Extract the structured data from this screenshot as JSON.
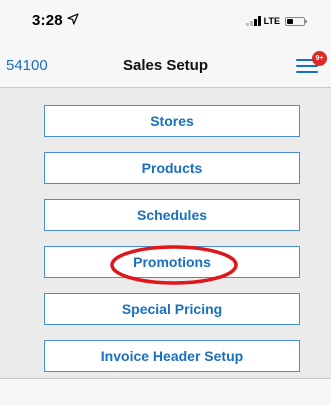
{
  "status_bar": {
    "time": "3:28",
    "network": "LTE",
    "battery_level": 0.35,
    "location_icon": "location-arrow-icon",
    "signal_icon": "signal-bars-icon",
    "battery_icon": "battery-icon"
  },
  "nav": {
    "left_label": "54100",
    "title": "Sales Setup",
    "menu_icon": "hamburger-menu-icon",
    "badge_text": "9+"
  },
  "menu": {
    "items": [
      {
        "label": "Stores"
      },
      {
        "label": "Products"
      },
      {
        "label": "Schedules"
      },
      {
        "label": "Promotions"
      },
      {
        "label": "Special Pricing"
      },
      {
        "label": "Invoice Header Setup"
      }
    ]
  },
  "annotation": {
    "highlight_color": "#e0161a",
    "highlighted_item": "Promotions"
  },
  "colors": {
    "accent": "#1a6fc0",
    "button_border": "#4a8fd3",
    "background": "#ebebeb",
    "bar_background": "#f7f7f7",
    "badge": "#e02a2a"
  }
}
